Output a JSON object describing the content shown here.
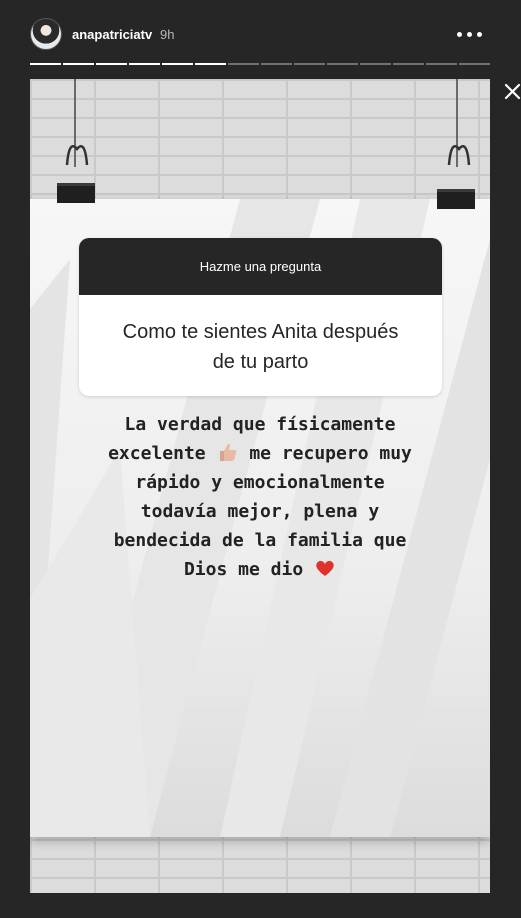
{
  "header": {
    "username": "anapatriciatv",
    "time": "9h",
    "progress_total": 14,
    "progress_filled": 6
  },
  "question": {
    "title": "Hazme una pregunta",
    "line1": "Como te sientes Anita después",
    "line2": "de tu parto"
  },
  "answer": {
    "line1": "La verdad que físicamente",
    "line2a": "excelente",
    "line2b": "me recupero muy",
    "line3": "rápido y emocionalmente",
    "line4": "todavía mejor, plena y",
    "line5": "bendecida de la familia que",
    "line6": "Dios me dio",
    "emoji1": "thumbs-up-icon",
    "emoji2": "red-heart-icon"
  },
  "colors": {
    "background": "#262626",
    "sticker_header": "#262626",
    "heart": "#e0322b"
  }
}
